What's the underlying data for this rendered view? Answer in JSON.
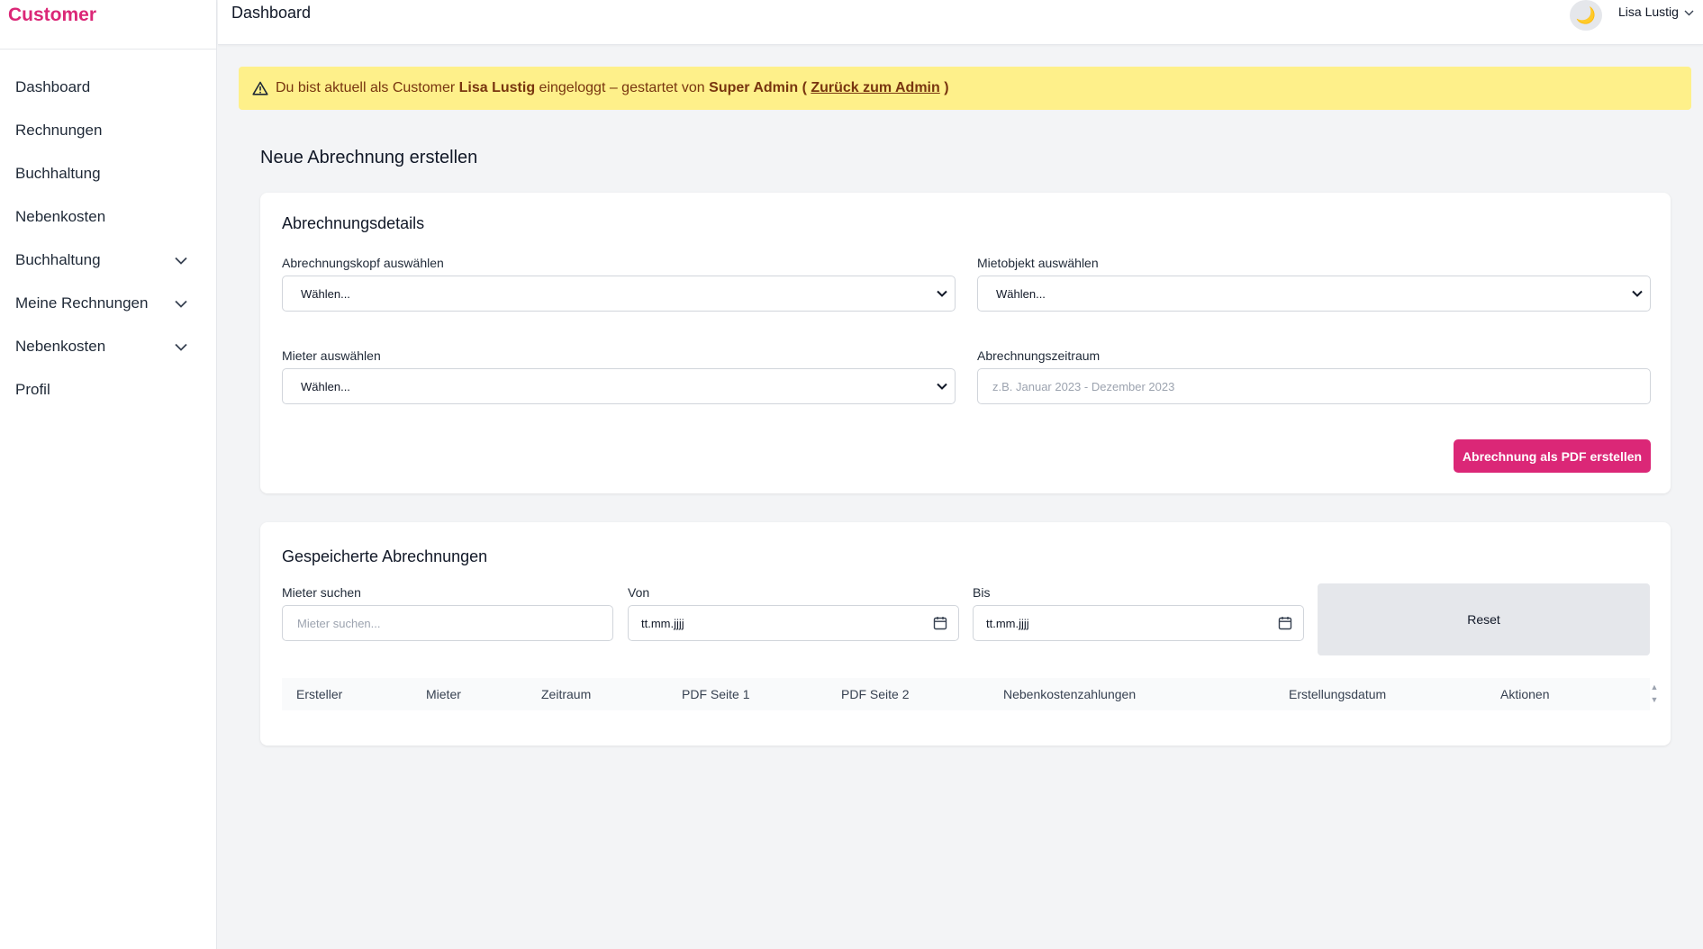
{
  "brand": "Customer",
  "sidebar": {
    "items": [
      {
        "label": "Dashboard"
      },
      {
        "label": "Rechnungen"
      },
      {
        "label": "Buchhaltung"
      },
      {
        "label": "Nebenkosten"
      },
      {
        "label": "Buchhaltung",
        "expandable": true
      },
      {
        "label": "Meine Rechnungen",
        "expandable": true
      },
      {
        "label": "Nebenkosten",
        "expandable": true
      },
      {
        "label": "Profil"
      }
    ]
  },
  "header": {
    "title": "Dashboard",
    "theme_icon": "moon-icon",
    "user_name": "Lisa Lustig"
  },
  "banner": {
    "icon": "warning-icon",
    "text_before": "Du bist aktuell als Customer",
    "user": "Lisa Lustig",
    "text_middle": "eingeloggt – gestartet von",
    "admin": "Super Admin",
    "paren_open": "(",
    "link": "Zurück zum Admin",
    "paren_close": ")"
  },
  "page": {
    "title": "Neue Abrechnung erstellen"
  },
  "details": {
    "title": "Abrechnungsdetails",
    "head_label": "Abrechnungskopf auswählen",
    "head_value": "Wählen...",
    "object_label": "Mietobjekt auswählen",
    "object_value": "Wählen...",
    "tenant_label": "Mieter auswählen",
    "tenant_value": "Wählen...",
    "period_label": "Abrechnungszeitraum",
    "period_placeholder": "z.B. Januar 2023 - Dezember 2023",
    "create_button": "Abrechnung als PDF erstellen"
  },
  "saved": {
    "title": "Gespeicherte Abrechnungen",
    "search_label": "Mieter suchen",
    "search_placeholder": "Mieter suchen...",
    "from_label": "Von",
    "from_value": "tt.mm.jjjj",
    "to_label": "Bis",
    "to_value": "tt.mm.jjjj",
    "reset_button": "Reset",
    "columns": [
      "Ersteller",
      "Mieter",
      "Zeitraum",
      "PDF Seite 1",
      "PDF Seite 2",
      "Nebenkostenzahlungen",
      "Erstellungsdatum",
      "Aktionen"
    ]
  },
  "colors": {
    "brand": "#db2777",
    "banner_bg": "#fef08a",
    "banner_text": "#78350f",
    "page_bg": "#f3f4f6"
  }
}
